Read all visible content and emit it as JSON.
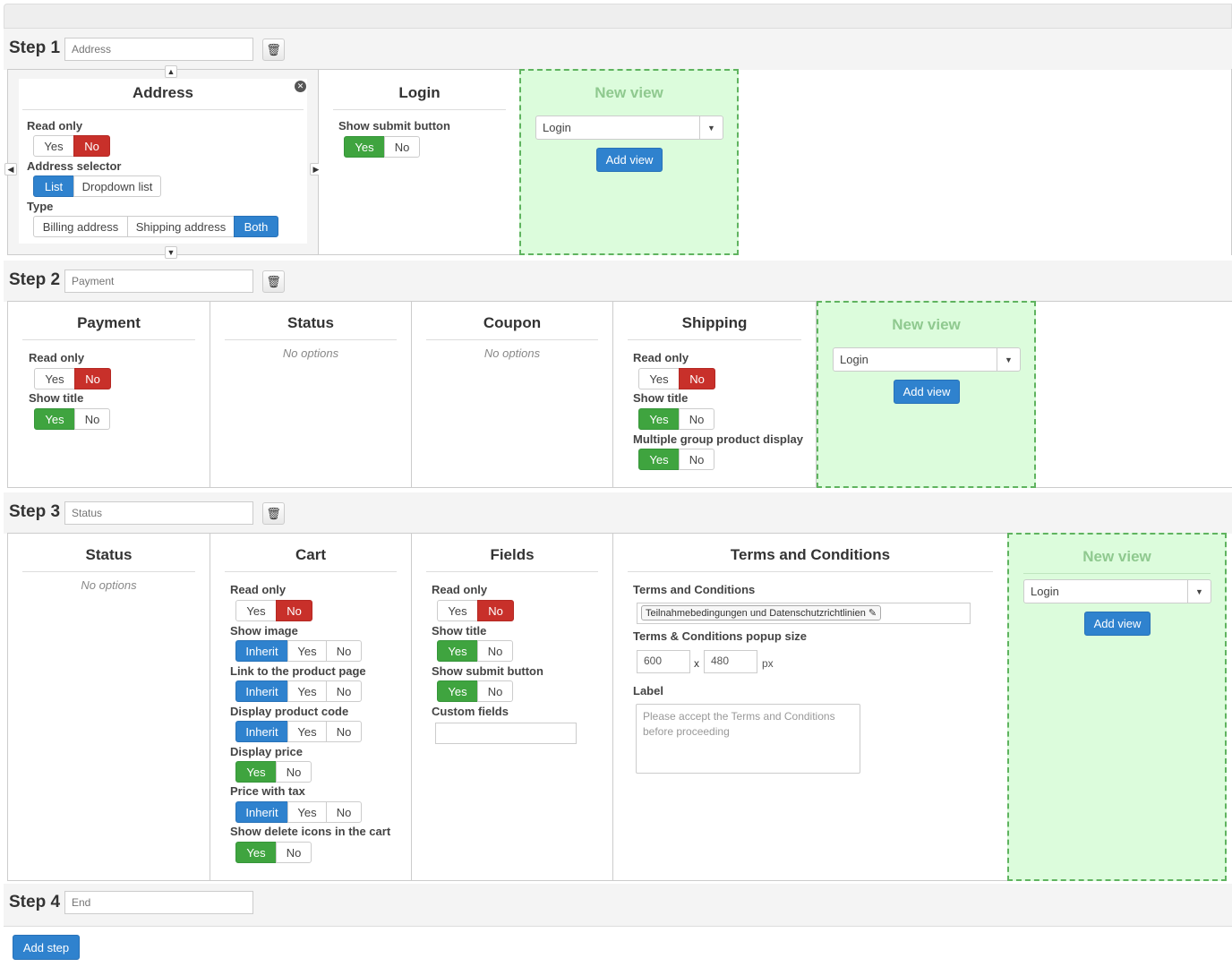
{
  "steps": [
    {
      "label": "Step",
      "num": "1",
      "name": "Address"
    },
    {
      "label": "Step",
      "num": "2",
      "name": "Payment"
    },
    {
      "label": "Step",
      "num": "3",
      "name": "Status"
    },
    {
      "label": "Step",
      "num": "4",
      "name": "End"
    }
  ],
  "yes": "Yes",
  "no": "No",
  "inherit": "Inherit",
  "no_options": "No options",
  "new_view": {
    "title": "New view",
    "select": "Login",
    "button": "Add view"
  },
  "s1": {
    "address": {
      "title": "Address",
      "read_only": "Read only",
      "address_selector": "Address selector",
      "list": "List",
      "dropdown": "Dropdown list",
      "type": "Type",
      "billing": "Billing address",
      "shipping": "Shipping address",
      "both": "Both"
    },
    "login": {
      "title": "Login",
      "show_submit": "Show submit button"
    }
  },
  "s2": {
    "payment": {
      "title": "Payment",
      "read_only": "Read only",
      "show_title": "Show title"
    },
    "status": {
      "title": "Status"
    },
    "coupon": {
      "title": "Coupon"
    },
    "shipping": {
      "title": "Shipping",
      "read_only": "Read only",
      "show_title": "Show title",
      "multiple": "Multiple group product display"
    }
  },
  "s3": {
    "status": {
      "title": "Status"
    },
    "cart": {
      "title": "Cart",
      "read_only": "Read only",
      "show_image": "Show image",
      "link": "Link to the product page",
      "code": "Display product code",
      "price": "Display price",
      "tax": "Price with tax",
      "delete": "Show delete icons in the cart"
    },
    "fields": {
      "title": "Fields",
      "read_only": "Read only",
      "show_title": "Show title",
      "show_submit": "Show submit button",
      "custom": "Custom fields"
    },
    "terms": {
      "title": "Terms and Conditions",
      "terms_label": "Terms and Conditions",
      "terms_value": "Teilnahmebedingungen und Datenschutzrichtlinien",
      "popup": "Terms & Conditions popup size",
      "w": "600",
      "x": "x",
      "h": "480",
      "px": "px",
      "label": "Label",
      "placeholder": "Please accept the Terms and Conditions before proceeding"
    }
  },
  "add_step": "Add step",
  "icons": {
    "trash": "trash-icon",
    "close": "close-circle-icon",
    "up": "chevron-up-icon",
    "down": "chevron-down-icon",
    "left": "chevron-left-icon",
    "right": "chevron-right-icon",
    "pencil": "pencil-icon",
    "caret": "caret-down-icon"
  }
}
